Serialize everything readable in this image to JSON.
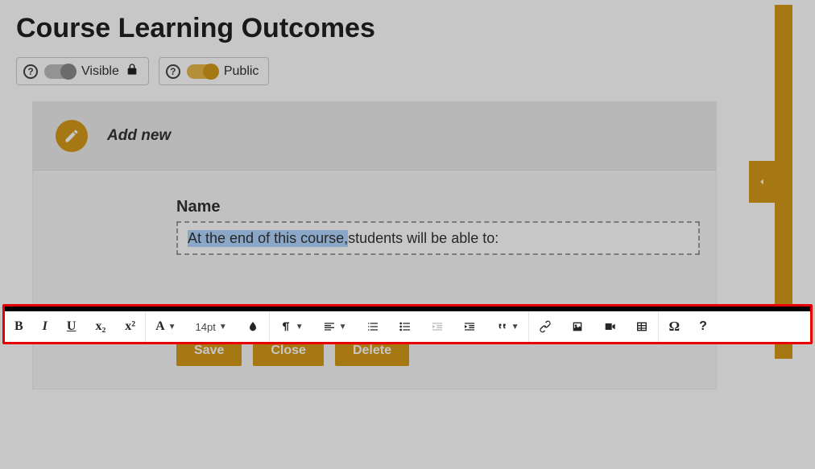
{
  "title": "Course Learning Outcomes",
  "visibility": {
    "visible_label": "Visible",
    "public_label": "Public"
  },
  "card": {
    "add_new_label": "Add new",
    "field_name_label": "Name",
    "input_selected_text": "At the end of this course, ",
    "input_rest_text": "students will be able to:"
  },
  "buttons": {
    "save": "Save",
    "close": "Close",
    "delete": "Delete"
  },
  "toolbar": {
    "bold_glyph": "B",
    "italic_glyph": "I",
    "underline_glyph": "U",
    "subscript_glyph": "x₂",
    "superscript_glyph": "x²",
    "font_family_glyph": "A",
    "font_size_label": "14pt",
    "omega_glyph": "Ω",
    "help_glyph": "?"
  }
}
